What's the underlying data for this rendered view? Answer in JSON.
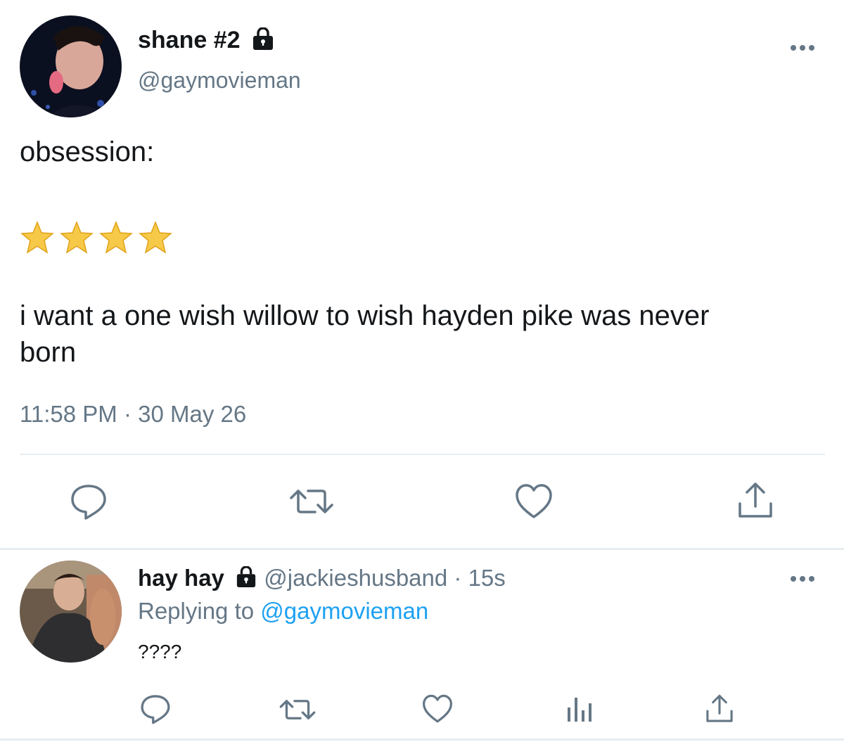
{
  "main_tweet": {
    "display_name": "shane #2",
    "handle": "@gaymovieman",
    "text_line1": "obsession:",
    "rating_stars": 4,
    "text_line3": "i want a one wish willow to wish hayden pike was never",
    "text_line4": "born",
    "timestamp": "11:58 PM · 30 May 26",
    "actions": [
      "reply-icon",
      "retweet-icon",
      "like-icon",
      "share-icon"
    ]
  },
  "reply_tweet": {
    "display_name": "hay hay",
    "handle": "@jackieshusband",
    "separator": " · ",
    "time_ago": "15s",
    "replying_to_label": "Replying to ",
    "replying_to_handle": "@gaymovieman",
    "text": "????",
    "actions": [
      "reply-icon",
      "retweet-icon",
      "like-icon",
      "analytics-icon",
      "share-icon"
    ]
  },
  "colors": {
    "text": "#14171a",
    "muted": "#657786",
    "link": "#1da1f2",
    "divider": "#e6ecf0",
    "icon": "#657786",
    "star": "#f5c518"
  }
}
